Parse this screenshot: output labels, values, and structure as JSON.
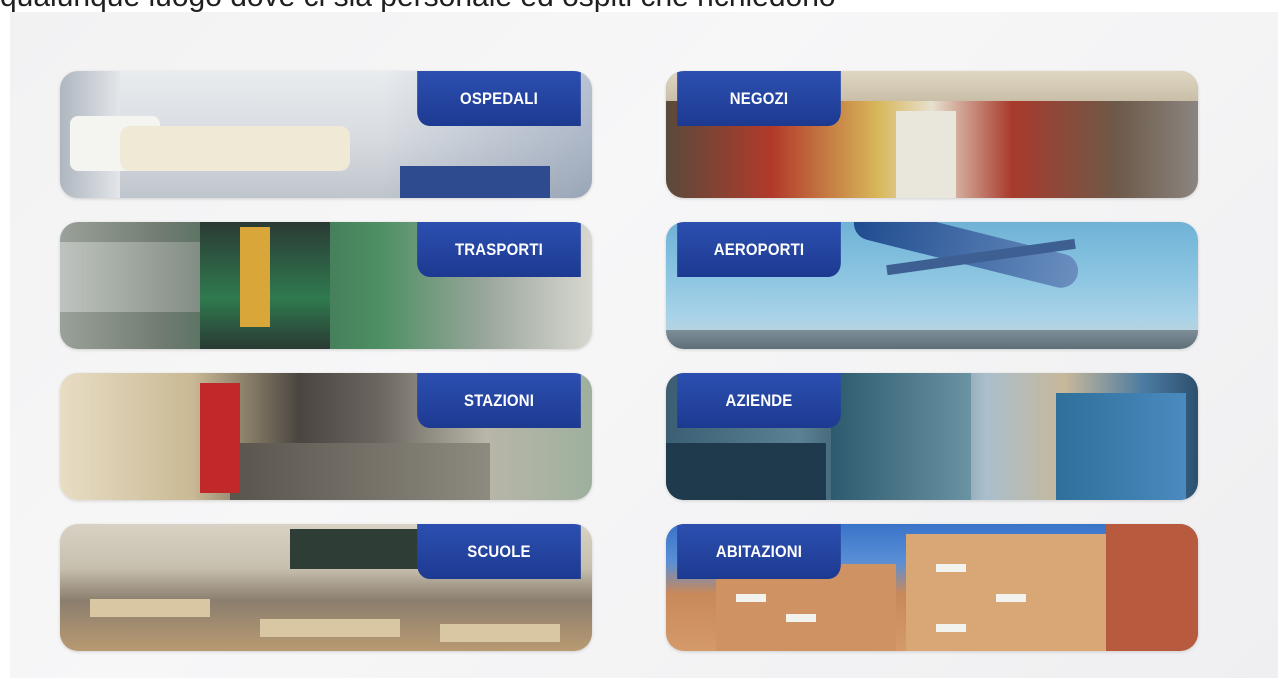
{
  "header": {
    "text": "qualunque luogo dove ci sia personale ed ospiti che richiedono"
  },
  "cards": [
    {
      "label": "OSPEDALI",
      "icon": "hospital-photo"
    },
    {
      "label": "NEGOZI",
      "icon": "shop-photo"
    },
    {
      "label": "TRASPORTI",
      "icon": "train-photo"
    },
    {
      "label": "AEROPORTI",
      "icon": "airplane-photo"
    },
    {
      "label": "STAZIONI",
      "icon": "station-photo"
    },
    {
      "label": "AZIENDE",
      "icon": "office-photo"
    },
    {
      "label": "SCUOLE",
      "icon": "classroom-photo"
    },
    {
      "label": "ABITAZIONI",
      "icon": "apartment-photo"
    }
  ],
  "colors": {
    "label_blue": "#1d3a91",
    "panel_bg": "#f2f2f3"
  }
}
